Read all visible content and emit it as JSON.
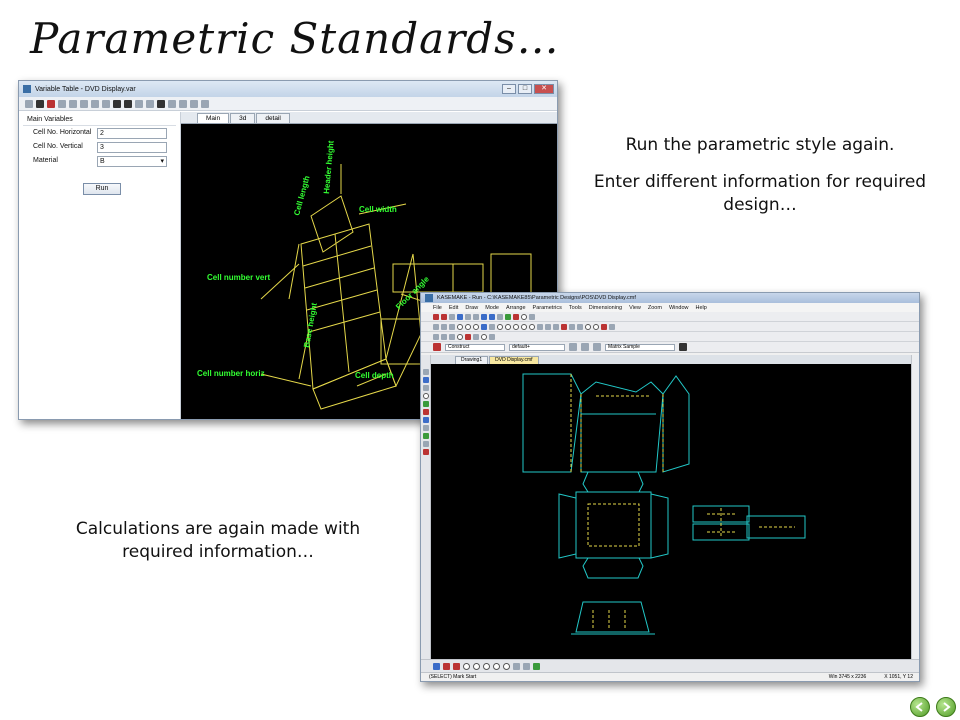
{
  "slide": {
    "title": "Parametric Standards…",
    "caption_top_1": "Run the parametric style again.",
    "caption_top_2": "Enter different information for required design…",
    "caption_bottom": "Calculations are again made with required information…"
  },
  "window1": {
    "title": "Variable Table - DVD Display.var",
    "group_label": "Main Variables",
    "fields": [
      {
        "label": "Cell No. Horizontal",
        "value": "2"
      },
      {
        "label": "Cell No. Vertical",
        "value": "3"
      },
      {
        "label": "Material",
        "value": "B"
      }
    ],
    "run_label": "Run",
    "tabs": [
      "Main",
      "3d",
      "detail"
    ],
    "drawing_labels": {
      "cell_length": "Cell length",
      "header_height": "Header height",
      "cell_width": "Cell width",
      "cell_number_vert": "Cell number vert",
      "floor_angle": "Floor angle",
      "base_height": "Base height",
      "cell_number_horiz": "Cell number horiz",
      "cell_depth": "Cell depth"
    },
    "colors": {
      "label": "#33ff33",
      "line": "#e5d84a",
      "canvas": "#000000"
    }
  },
  "window2": {
    "title": "KASEMAKE - Run - C:\\KASEMAKE85\\Parametric Designs\\POS\\DVD Display.cmf",
    "menu": [
      "File",
      "Edit",
      "Draw",
      "Mode",
      "Arrange",
      "Parametrics",
      "Tools",
      "Dimensioning",
      "View",
      "Zoom",
      "Window",
      "Help"
    ],
    "layer_combo": "Construct",
    "style_combo": "default+",
    "material_combo": "Matrix Sample",
    "doc_tabs": [
      "Drawing1",
      "DVD Display.cmf"
    ],
    "status_left": "(SELECT) Mark Start",
    "status_size": "Win 3745 x 2236",
    "status_coords": "X 1051, Y 12",
    "colors": {
      "cut": "#22c8c8",
      "crease": "#e5d84a"
    }
  }
}
